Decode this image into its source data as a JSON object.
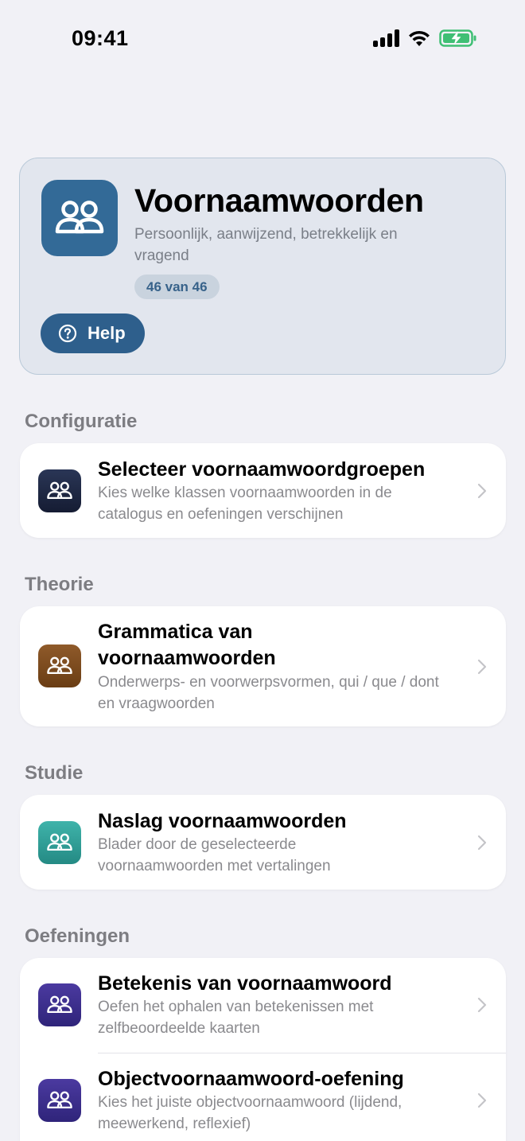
{
  "status": {
    "time": "09:41"
  },
  "hero": {
    "icon": "people-icon",
    "title": "Voornaamwoorden",
    "subtitle": "Persoonlijk, aanwijzend, betrekkelijk en vragend",
    "badge": "46 van 46",
    "help_label": "Help",
    "colors": {
      "accent": "#336a97",
      "card_bg": "#e2e6ee"
    }
  },
  "sections": {
    "config": {
      "title": "Configuratie",
      "items": [
        {
          "title": "Selecteer voornaamwoordgroepen",
          "subtitle": "Kies welke klassen voornaamwoorden in de catalogus en oefeningen verschijnen",
          "icon": "people-icon",
          "color": "#1f2a45"
        }
      ]
    },
    "theory": {
      "title": "Theorie",
      "items": [
        {
          "title": "Grammatica van voornaamwoorden",
          "subtitle": "Onderwerps- en voorwerpsvormen, qui / que / dont en vraagwoorden",
          "icon": "people-icon",
          "color": "#7b4a1e"
        }
      ]
    },
    "study": {
      "title": "Studie",
      "items": [
        {
          "title": "Naslag voornaamwoorden",
          "subtitle": "Blader door de geselecteerde voornaamwoorden met vertalingen",
          "icon": "people-icon",
          "color": "#2f9e97"
        }
      ]
    },
    "exercises": {
      "title": "Oefeningen",
      "items": [
        {
          "title": "Betekenis van voornaamwoord",
          "subtitle": "Oefen het ophalen van betekenissen met zelfbeoordeelde kaarten",
          "icon": "people-icon",
          "color": "#3d2f8c"
        },
        {
          "title": "Objectvoornaamwoord-oefening",
          "subtitle": "Kies het juiste objectvoornaamwoord (lijdend, meewerkend, reflexief)",
          "icon": "people-icon",
          "color": "#3d2f8c"
        }
      ]
    }
  }
}
